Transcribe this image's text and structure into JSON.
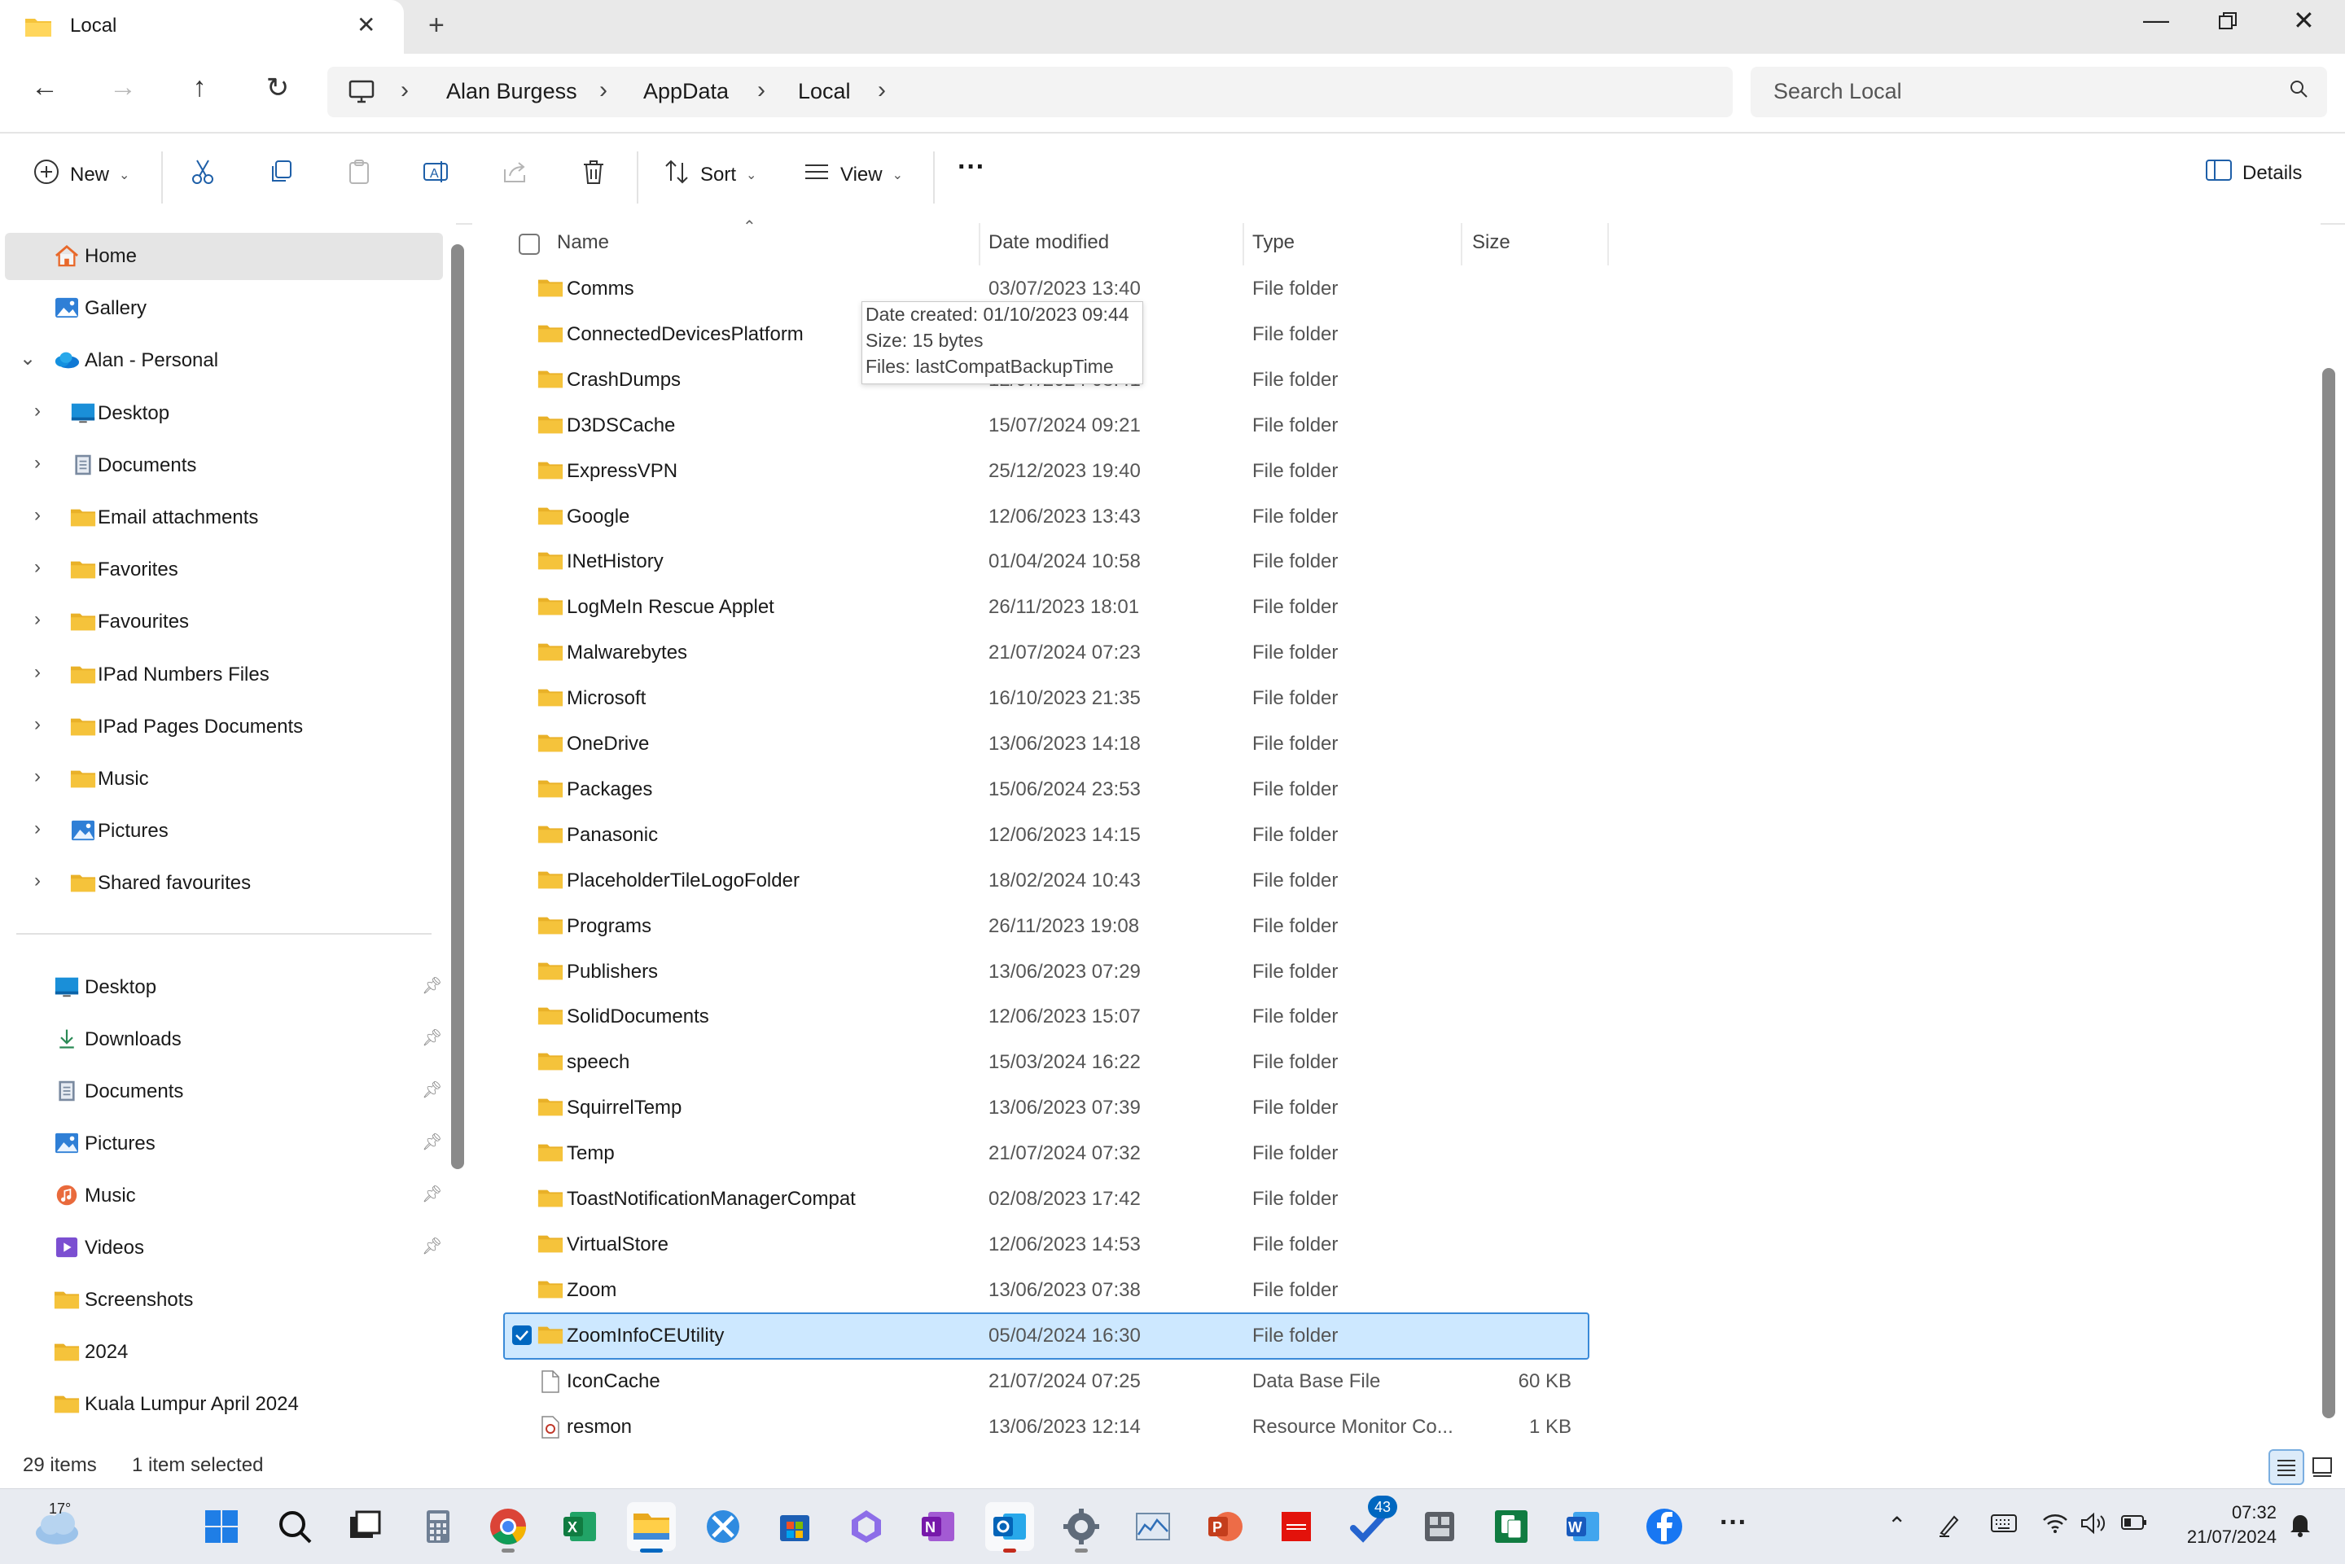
{
  "tab": {
    "title": "Local"
  },
  "address": {
    "crumbs": [
      "Alan Burgess",
      "AppData",
      "Local"
    ],
    "search_placeholder": "Search Local"
  },
  "commands": {
    "new": "New",
    "sort": "Sort",
    "view": "View",
    "details": "Details"
  },
  "sidebar": {
    "items": [
      {
        "label": "Home",
        "icon": "home-icon",
        "chevron": false,
        "indent": 0,
        "selected": true
      },
      {
        "label": "Gallery",
        "icon": "gallery-icon",
        "chevron": false,
        "indent": 0
      },
      {
        "label": "Alan - Personal",
        "icon": "onedrive-icon",
        "chevron": "expanded",
        "indent": 0
      },
      {
        "label": "Desktop",
        "icon": "desktop-icon",
        "chevron": "collapsed",
        "indent": 1
      },
      {
        "label": "Documents",
        "icon": "documents-icon",
        "chevron": "collapsed",
        "indent": 1
      },
      {
        "label": "Email attachments",
        "icon": "folder-icon",
        "chevron": "collapsed",
        "indent": 1
      },
      {
        "label": "Favorites",
        "icon": "folder-icon",
        "chevron": "collapsed",
        "indent": 1
      },
      {
        "label": "Favourites",
        "icon": "folder-icon",
        "chevron": "collapsed",
        "indent": 1
      },
      {
        "label": "IPad Numbers Files",
        "icon": "folder-icon",
        "chevron": "collapsed",
        "indent": 1
      },
      {
        "label": "IPad Pages Documents",
        "icon": "folder-icon",
        "chevron": "collapsed",
        "indent": 1
      },
      {
        "label": "Music",
        "icon": "folder-icon",
        "chevron": "collapsed",
        "indent": 1
      },
      {
        "label": "Pictures",
        "icon": "pictures-icon",
        "chevron": "collapsed",
        "indent": 1
      },
      {
        "label": "Shared favourites",
        "icon": "folder-icon",
        "chevron": "collapsed",
        "indent": 1
      }
    ],
    "quick_access": [
      {
        "label": "Desktop",
        "icon": "desktop-icon",
        "pinned": true
      },
      {
        "label": "Downloads",
        "icon": "downloads-icon",
        "pinned": true
      },
      {
        "label": "Documents",
        "icon": "documents-icon",
        "pinned": true
      },
      {
        "label": "Pictures",
        "icon": "pictures-icon",
        "pinned": true
      },
      {
        "label": "Music",
        "icon": "music-icon",
        "pinned": true
      },
      {
        "label": "Videos",
        "icon": "videos-icon",
        "pinned": true
      },
      {
        "label": "Screenshots",
        "icon": "folder-icon",
        "pinned": false
      },
      {
        "label": "2024",
        "icon": "folder-icon",
        "pinned": false
      },
      {
        "label": "Kuala Lumpur April 2024",
        "icon": "folder-icon",
        "pinned": false
      }
    ]
  },
  "columns": {
    "name": "Name",
    "date": "Date modified",
    "type": "Type",
    "size": "Size"
  },
  "files": [
    {
      "name": "Comms",
      "date": "03/07/2023 13:40",
      "type": "File folder",
      "size": "",
      "icon": "folder"
    },
    {
      "name": "ConnectedDevicesPlatform",
      "date": "",
      "type": "File folder",
      "size": "",
      "icon": "folder"
    },
    {
      "name": "CrashDumps",
      "date": "12/07/2024 08:41",
      "type": "File folder",
      "size": "",
      "icon": "folder"
    },
    {
      "name": "D3DSCache",
      "date": "15/07/2024 09:21",
      "type": "File folder",
      "size": "",
      "icon": "folder"
    },
    {
      "name": "ExpressVPN",
      "date": "25/12/2023 19:40",
      "type": "File folder",
      "size": "",
      "icon": "folder"
    },
    {
      "name": "Google",
      "date": "12/06/2023 13:43",
      "type": "File folder",
      "size": "",
      "icon": "folder"
    },
    {
      "name": "INetHistory",
      "date": "01/04/2024 10:58",
      "type": "File folder",
      "size": "",
      "icon": "folder"
    },
    {
      "name": "LogMeIn Rescue Applet",
      "date": "26/11/2023 18:01",
      "type": "File folder",
      "size": "",
      "icon": "folder"
    },
    {
      "name": "Malwarebytes",
      "date": "21/07/2024 07:23",
      "type": "File folder",
      "size": "",
      "icon": "folder"
    },
    {
      "name": "Microsoft",
      "date": "16/10/2023 21:35",
      "type": "File folder",
      "size": "",
      "icon": "folder"
    },
    {
      "name": "OneDrive",
      "date": "13/06/2023 14:18",
      "type": "File folder",
      "size": "",
      "icon": "folder"
    },
    {
      "name": "Packages",
      "date": "15/06/2024 23:53",
      "type": "File folder",
      "size": "",
      "icon": "folder"
    },
    {
      "name": "Panasonic",
      "date": "12/06/2023 14:15",
      "type": "File folder",
      "size": "",
      "icon": "folder"
    },
    {
      "name": "PlaceholderTileLogoFolder",
      "date": "18/02/2024 10:43",
      "type": "File folder",
      "size": "",
      "icon": "folder"
    },
    {
      "name": "Programs",
      "date": "26/11/2023 19:08",
      "type": "File folder",
      "size": "",
      "icon": "folder"
    },
    {
      "name": "Publishers",
      "date": "13/06/2023 07:29",
      "type": "File folder",
      "size": "",
      "icon": "folder"
    },
    {
      "name": "SolidDocuments",
      "date": "12/06/2023 15:07",
      "type": "File folder",
      "size": "",
      "icon": "folder"
    },
    {
      "name": "speech",
      "date": "15/03/2024 16:22",
      "type": "File folder",
      "size": "",
      "icon": "folder"
    },
    {
      "name": "SquirrelTemp",
      "date": "13/06/2023 07:39",
      "type": "File folder",
      "size": "",
      "icon": "folder"
    },
    {
      "name": "Temp",
      "date": "21/07/2024 07:32",
      "type": "File folder",
      "size": "",
      "icon": "folder"
    },
    {
      "name": "ToastNotificationManagerCompat",
      "date": "02/08/2023 17:42",
      "type": "File folder",
      "size": "",
      "icon": "folder"
    },
    {
      "name": "VirtualStore",
      "date": "12/06/2023 14:53",
      "type": "File folder",
      "size": "",
      "icon": "folder"
    },
    {
      "name": "Zoom",
      "date": "13/06/2023 07:38",
      "type": "File folder",
      "size": "",
      "icon": "folder"
    },
    {
      "name": "ZoomInfoCEUtility",
      "date": "05/04/2024 16:30",
      "type": "File folder",
      "size": "",
      "icon": "folder",
      "selected": true
    },
    {
      "name": "IconCache",
      "date": "21/07/2024 07:25",
      "type": "Data Base File",
      "size": "60 KB",
      "icon": "file"
    },
    {
      "name": "resmon",
      "date": "13/06/2023 12:14",
      "type": "Resource Monitor Co...",
      "size": "1 KB",
      "icon": "resmon"
    }
  ],
  "tooltip": {
    "lines": [
      "Date created: 01/10/2023 09:44",
      "Size: 15 bytes",
      "Files: lastCompatBackupTime"
    ]
  },
  "status": {
    "count": "29 items",
    "selection": "1 item selected"
  },
  "taskbar": {
    "weather_temp": "17°",
    "badge": "43",
    "time": "07:32",
    "date": "21/07/2024"
  },
  "colors": {
    "folder": "#f5c33b",
    "accent": "#0067c0",
    "selection": "#cde8ff"
  }
}
